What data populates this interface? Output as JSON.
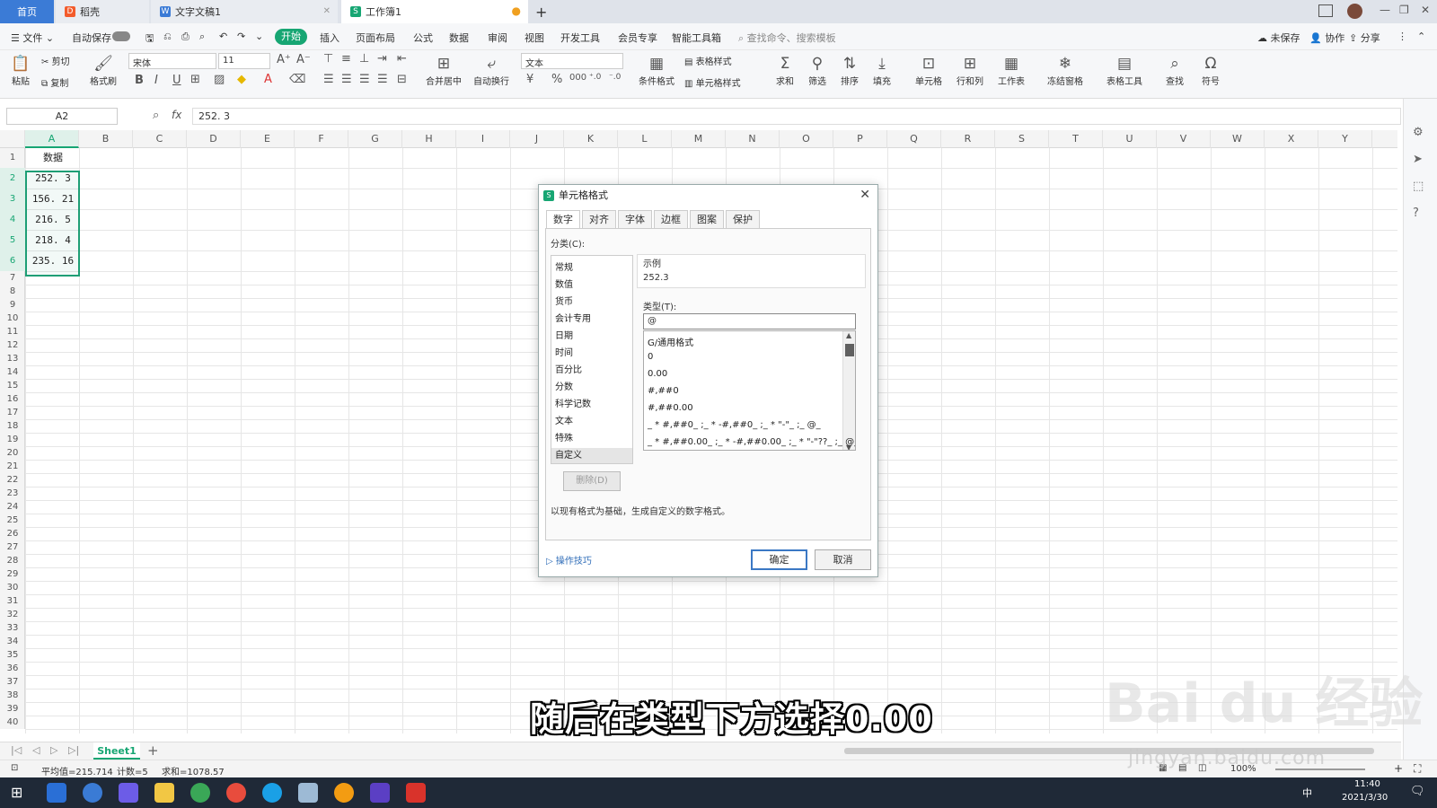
{
  "tabs": {
    "home": "首页",
    "shell": "稻壳",
    "doc": "文字文稿1",
    "sheet": "工作簿1"
  },
  "menu": {
    "file": "文件",
    "autosave": "自动保存",
    "start": "开始",
    "insert": "插入",
    "layout": "页面布局",
    "formula": "公式",
    "data": "数据",
    "review": "审阅",
    "view": "视图",
    "dev": "开发工具",
    "member": "会员专享",
    "smart": "智能工具箱",
    "search": "查找命令、搜索模板",
    "unsaved": "未保存",
    "collab": "协作",
    "share": "分享"
  },
  "ribbon": {
    "paste": "粘贴",
    "cut": "剪切",
    "copy": "复制",
    "format_painter": "格式刷",
    "font": "宋体",
    "size": "11",
    "merge": "合并居中",
    "wrap": "自动换行",
    "numfmt": "文本",
    "cond": "条件格式",
    "table_style": "表格样式",
    "cell_style": "单元格样式",
    "sum": "求和",
    "filter": "筛选",
    "sort": "排序",
    "fill": "填充",
    "cell": "单元格",
    "rowcol": "行和列",
    "worksheet": "工作表",
    "freeze": "冻结窗格",
    "table_tools": "表格工具",
    "find": "查找",
    "symbol": "符号"
  },
  "formula_bar": {
    "name": "A2",
    "value": "252. 3"
  },
  "sheet": {
    "columns": [
      "A",
      "B",
      "C",
      "D",
      "E",
      "F",
      "G",
      "H",
      "I",
      "J",
      "K",
      "L",
      "M",
      "N",
      "O",
      "P",
      "Q",
      "R",
      "S",
      "T",
      "U",
      "V",
      "W",
      "X",
      "Y"
    ],
    "rows": [
      "1",
      "2",
      "3",
      "4",
      "5",
      "6",
      "7",
      "8",
      "9",
      "10",
      "11",
      "12",
      "13",
      "14",
      "15",
      "16",
      "17",
      "18",
      "19",
      "20",
      "21",
      "22",
      "23",
      "24",
      "25",
      "26",
      "27",
      "28",
      "29",
      "30",
      "31",
      "32",
      "33",
      "34",
      "35",
      "36",
      "37",
      "38",
      "39",
      "40"
    ],
    "cells": [
      "数据",
      "252. 3",
      "156. 21",
      "216. 5",
      "218. 4",
      "235. 16"
    ]
  },
  "dialog": {
    "title": "单元格格式",
    "tabs": [
      "数字",
      "对齐",
      "字体",
      "边框",
      "图案",
      "保护"
    ],
    "category_label": "分类(C):",
    "categories": [
      "常规",
      "数值",
      "货币",
      "会计专用",
      "日期",
      "时间",
      "百分比",
      "分数",
      "科学记数",
      "文本",
      "特殊",
      "自定义"
    ],
    "sample_label": "示例",
    "sample_value": "252.3",
    "type_label": "类型(T):",
    "type_value": "@",
    "type_options": [
      "G/通用格式",
      "0",
      "0.00",
      "#,##0",
      "#,##0.00",
      "_ * #,##0_ ;_ * -#,##0_ ;_ * \"-\"_ ;_ @_",
      "_ * #,##0.00_ ;_ * -#,##0.00_ ;_ * \"-\"??_ ;_ @_"
    ],
    "delete": "删除(D)",
    "description": "以现有格式为基础，生成自定义的数字格式。",
    "tips": "操作技巧",
    "ok": "确定",
    "cancel": "取消"
  },
  "sheet_tab": "Sheet1",
  "status": {
    "avg": "平均值=215.714",
    "count": "计数=5",
    "sum": "求和=1078.57",
    "zoom": "100%"
  },
  "taskbar": {
    "time": "11:40",
    "date": "2021/3/30",
    "ime": "中"
  },
  "subtitle": "随后在类型下方选择0.00",
  "watermark": {
    "brand": "Bai du 经验",
    "url": "jingyan.baidu.com"
  },
  "colors": {
    "accent": "#1e9e75",
    "start": "#17a673"
  }
}
